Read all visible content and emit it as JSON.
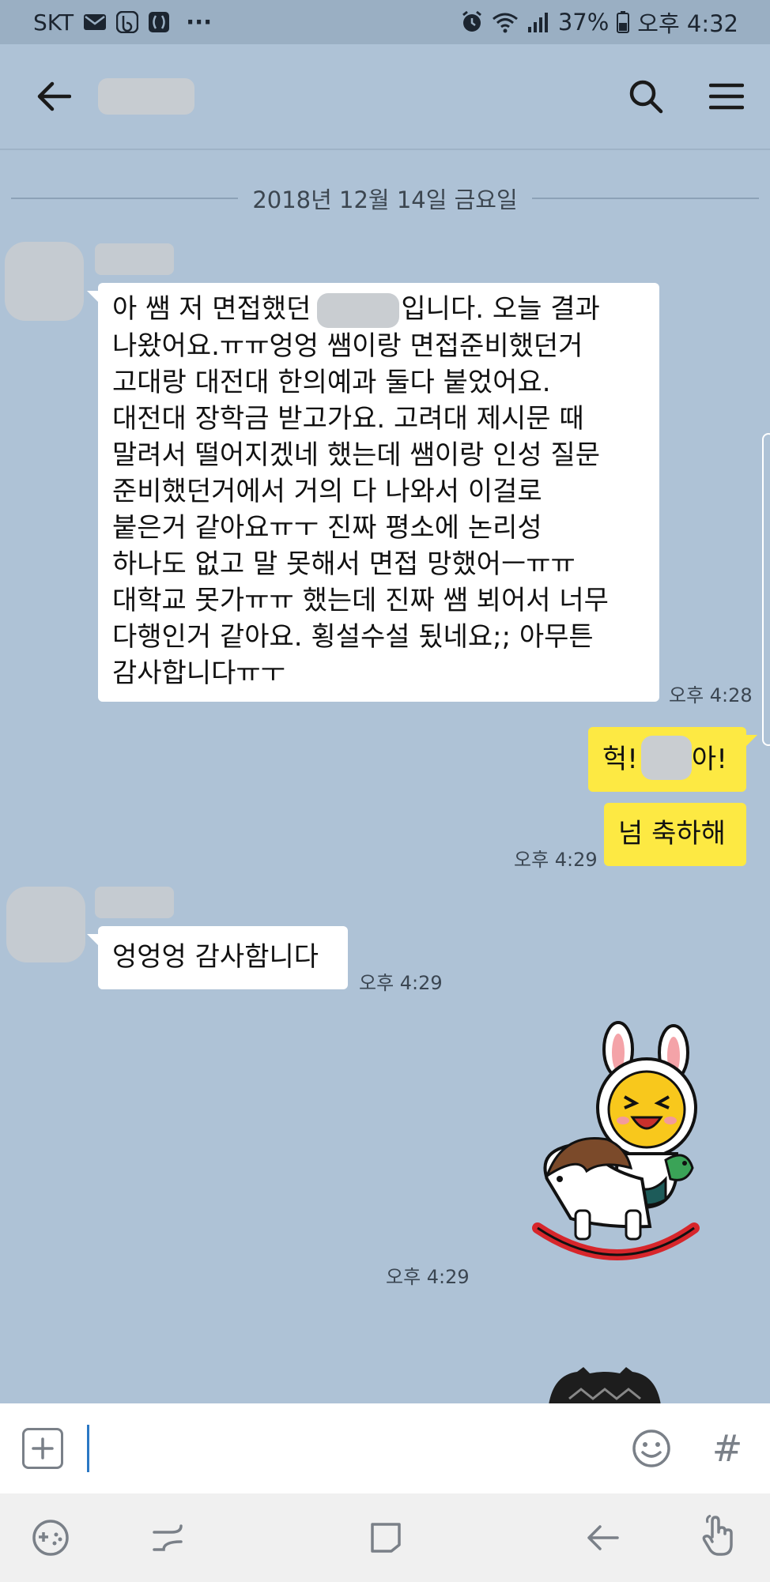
{
  "status_bar": {
    "carrier": "SKT",
    "more": "···",
    "battery": "37%",
    "clock": "오후 4:32"
  },
  "header": {
    "back_icon": "arrow-left-icon",
    "search_icon": "search-icon",
    "menu_icon": "hamburger-menu-icon"
  },
  "chat": {
    "date_divider": "2018년 12월 14일 금요일",
    "messages": [
      {
        "lines": [
          "아 쌤 저 면접했던",
          "입니다. 오늘 결과",
          "나왔어요.ㅠㅠ엉엉 쌤이랑 면접준비했던거",
          "고대랑 대전대 한의예과 둘다 붙었어요.",
          "대전대  장학금 받고가요. 고려대 제시문 때",
          "말려서 떨어지겠네 했는데 쌤이랑 인성 질문",
          "준비했던거에서 거의 다 나와서 이걸로",
          "붙은거 같아요ㅠㅜ 진짜 평소에 논리성",
          "하나도 없고 말 못해서 면접 망했어ㅡㅠㅠ",
          "대학교 못가ㅠㅠ 했는데 진짜 쌤 뵈어서 너무",
          "다행인거 같아요. 횡설수설 됬네요;;  아무튼",
          "감사합니다ㅠㅜ"
        ],
        "time": "오후 4:28"
      },
      {
        "pre": "헉!",
        "post": "아!"
      },
      {
        "text": "넘 축하해",
        "time": "오후 4:29"
      },
      {
        "text": "엉엉엉 감사함니다",
        "time": "오후 4:29"
      },
      {
        "sticker": "rabbit-on-rocking-horse-sticker",
        "time": "오후 4:29"
      }
    ]
  },
  "input_bar": {
    "value": "",
    "hash": "#"
  },
  "colors": {
    "background": "#aec2d6",
    "my_bubble": "#fde943",
    "other_bubble": "#ffffff"
  }
}
